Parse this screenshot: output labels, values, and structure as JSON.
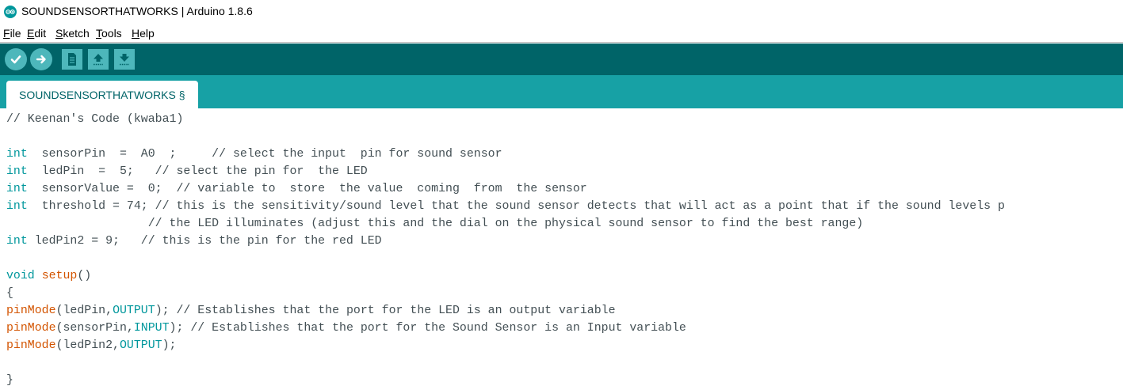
{
  "window": {
    "title": "SOUNDSENSORTHATWORKS | Arduino 1.8.6"
  },
  "menu": {
    "items": [
      {
        "key": "F",
        "rest": "ile"
      },
      {
        "key": "E",
        "rest": "dit"
      },
      {
        "key": "S",
        "rest": "ketch"
      },
      {
        "key": "T",
        "rest": "ools"
      },
      {
        "key": "H",
        "rest": "elp"
      }
    ]
  },
  "toolbar": {
    "buttons": [
      "verify-icon",
      "upload-icon",
      "new-icon",
      "open-icon",
      "save-icon"
    ]
  },
  "tabs": [
    {
      "label": "SOUNDSENSORTHATWORKS §"
    }
  ],
  "colors": {
    "toolbar_bg": "#006468",
    "tabstrip_bg": "#17a1a5",
    "keyword": "#00979c",
    "function": "#d35400",
    "code_text": "#434f54"
  },
  "code": {
    "lines": [
      [
        {
          "t": "// Keenan's Code (kwaba1)"
        }
      ],
      [],
      [
        {
          "t": "int",
          "c": "kw"
        },
        {
          "t": "  sensorPin  =  A0  ;     // select the input  pin for sound sensor"
        }
      ],
      [
        {
          "t": "int",
          "c": "kw"
        },
        {
          "t": "  ledPin  =  5;   // select the pin for  the LED"
        }
      ],
      [
        {
          "t": "int",
          "c": "kw"
        },
        {
          "t": "  sensorValue =  0;  // variable to  store  the value  coming  from  the sensor"
        }
      ],
      [
        {
          "t": "int",
          "c": "kw"
        },
        {
          "t": "  threshold = 74; // this is the sensitivity/sound level that the sound sensor detects that will act as a point that if the sound levels p"
        }
      ],
      [
        {
          "t": "                    // the LED illuminates (adjust this and the dial on the physical sound sensor to find the best range)"
        }
      ],
      [
        {
          "t": "int",
          "c": "kw"
        },
        {
          "t": " ledPin2 = 9;   // this is the pin for the red LED"
        }
      ],
      [],
      [
        {
          "t": "void",
          "c": "kw"
        },
        {
          "t": " "
        },
        {
          "t": "setup",
          "c": "fn"
        },
        {
          "t": "()"
        }
      ],
      [
        {
          "t": "{"
        }
      ],
      [
        {
          "t": "pinMode",
          "c": "fn"
        },
        {
          "t": "(ledPin,"
        },
        {
          "t": "OUTPUT",
          "c": "cst"
        },
        {
          "t": "); // Establishes that the port for the LED is an output variable"
        }
      ],
      [
        {
          "t": "pinMode",
          "c": "fn"
        },
        {
          "t": "(sensorPin,"
        },
        {
          "t": "INPUT",
          "c": "cst"
        },
        {
          "t": "); // Establishes that the port for the Sound Sensor is an Input variable"
        }
      ],
      [
        {
          "t": "pinMode",
          "c": "fn"
        },
        {
          "t": "(ledPin2,"
        },
        {
          "t": "OUTPUT",
          "c": "cst"
        },
        {
          "t": ");"
        }
      ],
      [],
      [
        {
          "t": "}"
        }
      ]
    ]
  }
}
